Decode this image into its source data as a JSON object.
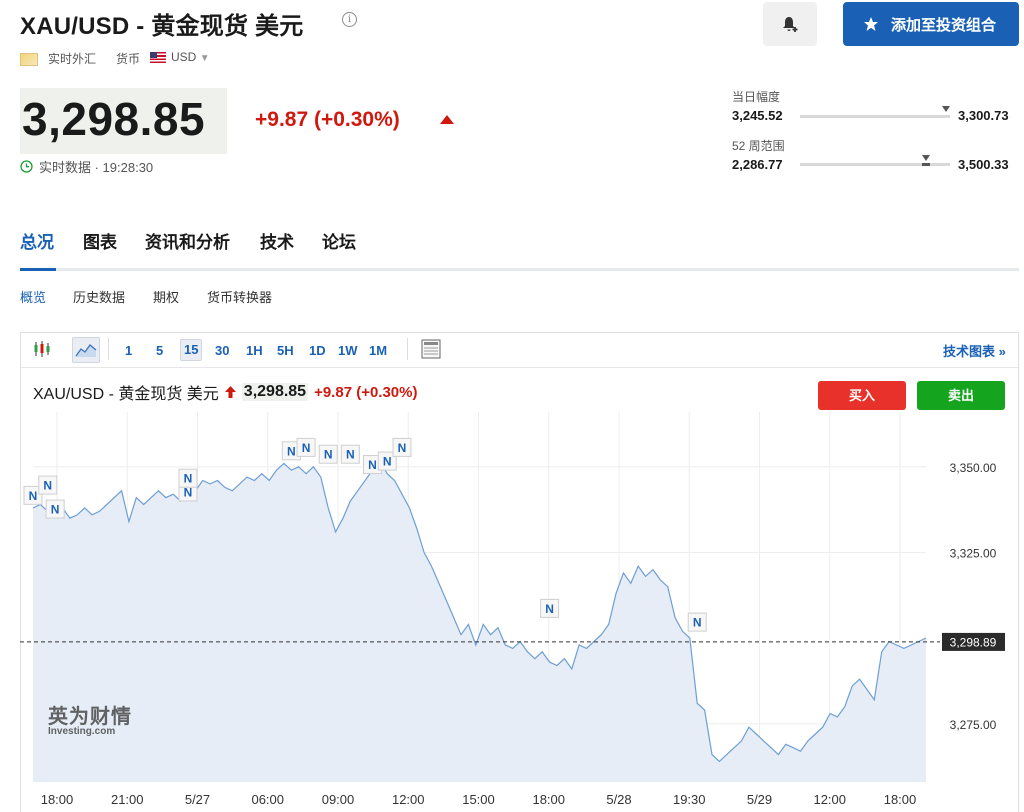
{
  "header": {
    "title": "XAU/USD - 黄金现货 美元",
    "info_icon": "i",
    "add_button": "添加至投资组合",
    "market": "实时外汇",
    "currency_label": "货币",
    "currency_value": "USD"
  },
  "quote": {
    "price": "3,298.85",
    "change": "+9.87 (+0.30%)",
    "realtime_label": "实时数据 · 19:28:30"
  },
  "ranges": {
    "day": {
      "label": "当日幅度",
      "low": "3,245.52",
      "high": "3,300.73",
      "position": 0.97
    },
    "week52": {
      "label": "52 周范围",
      "low": "2,286.77",
      "high": "3,500.33",
      "position": 0.84
    }
  },
  "nav": {
    "tabs": [
      "总况",
      "图表",
      "资讯和分析",
      "技术",
      "论坛"
    ]
  },
  "subnav": {
    "items": [
      "概览",
      "历史数据",
      "期权",
      "货币转换器"
    ]
  },
  "toolbar": {
    "timeframes": [
      "1",
      "5",
      "15",
      "30",
      "1H",
      "5H",
      "1D",
      "1W",
      "1M"
    ],
    "selected": "15",
    "tech_chart": "技术图表 »"
  },
  "chart_header": {
    "title": "XAU/USD - 黄金现货 美元",
    "price": "3,298.85",
    "change": "+9.87 (+0.30%)",
    "buy": "买入",
    "sell": "卖出"
  },
  "watermark": {
    "cn": "英为财情",
    "en": "Investing.com"
  },
  "colors": {
    "accent": "#1a61b6",
    "up": "#d0190e",
    "buy": "#e8312a",
    "sell": "#14a41e",
    "line": "#6d9fd4",
    "area": "#e6edf6"
  },
  "chart_data": {
    "type": "area",
    "x_ticks": [
      "18:00",
      "21:00",
      "5/27",
      "06:00",
      "09:00",
      "12:00",
      "15:00",
      "18:00",
      "5/28",
      "19:30",
      "5/29",
      "12:00",
      "18:00"
    ],
    "y_ticks": [
      3350.0,
      3325.0,
      3275.0
    ],
    "ylim": [
      3258,
      3366
    ],
    "last_value": "3,298.89",
    "last_value_num": 3298.89,
    "values": [
      3338,
      3339,
      3337,
      3336,
      3338,
      3335,
      3336,
      3338,
      3336,
      3337,
      3339,
      3341,
      3343,
      3334,
      3341,
      3339,
      3341,
      3343,
      3341,
      3342,
      3340,
      3341,
      3343,
      3346,
      3345,
      3346,
      3344,
      3343,
      3345,
      3347,
      3346,
      3348,
      3346,
      3349,
      3351,
      3349,
      3350,
      3348,
      3350,
      3347,
      3338,
      3331,
      3335,
      3340,
      3343,
      3346,
      3349,
      3352,
      3348,
      3346,
      3342,
      3338,
      3332,
      3325,
      3321,
      3316,
      3311,
      3306,
      3301,
      3304,
      3298,
      3304,
      3301,
      3303,
      3298,
      3297,
      3299,
      3296,
      3294,
      3296,
      3293,
      3292,
      3294,
      3291,
      3298,
      3297,
      3299,
      3301,
      3304,
      3313,
      3319,
      3316,
      3321,
      3318,
      3320,
      3317,
      3315,
      3306,
      3302,
      3300,
      3281,
      3279,
      3266,
      3264,
      3266,
      3268,
      3270,
      3274,
      3272,
      3270,
      3268,
      3266,
      3269,
      3268,
      3267,
      3270,
      3272,
      3274,
      3278,
      3277,
      3280,
      3286,
      3288,
      3285,
      3282,
      3296,
      3299,
      3298,
      3297,
      3298,
      3299,
      3300
    ],
    "news_markers": [
      [
        0,
        3337
      ],
      [
        2,
        3340
      ],
      [
        3,
        3333
      ],
      [
        21,
        3338
      ],
      [
        21,
        3342
      ],
      [
        35,
        3350
      ],
      [
        37,
        3351
      ],
      [
        40,
        3349
      ],
      [
        43,
        3349
      ],
      [
        46,
        3346
      ],
      [
        48,
        3347
      ],
      [
        50,
        3351
      ],
      [
        70,
        3304
      ],
      [
        90,
        3300
      ]
    ]
  }
}
